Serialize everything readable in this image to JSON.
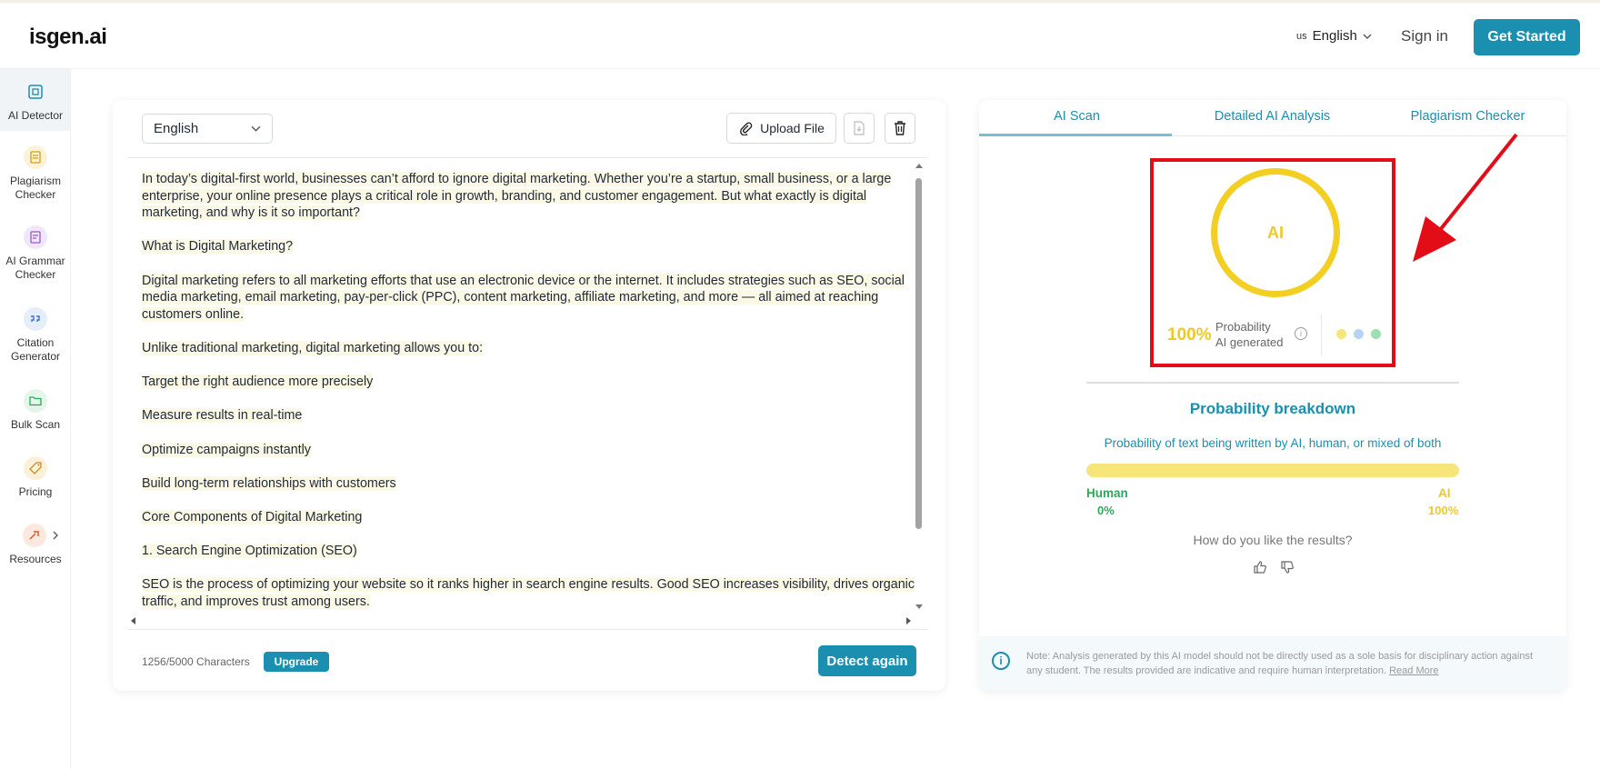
{
  "header": {
    "logo": "isgen.ai",
    "language_flag": "us",
    "language": "English",
    "sign_in": "Sign in",
    "get_started": "Get Started"
  },
  "sidebar": {
    "items": [
      {
        "label": "AI Detector",
        "icon": "ai-detector-icon"
      },
      {
        "label": "Plagiarism Checker",
        "icon": "plagiarism-icon"
      },
      {
        "label": "AI Grammar Checker",
        "icon": "grammar-icon"
      },
      {
        "label": "Citation Generator",
        "icon": "citation-icon"
      },
      {
        "label": "Bulk Scan",
        "icon": "folder-icon"
      },
      {
        "label": "Pricing",
        "icon": "price-tag-icon"
      },
      {
        "label": "Resources",
        "icon": "resources-icon"
      }
    ]
  },
  "editor": {
    "language_select": "English",
    "upload_label": "Upload File",
    "paragraphs": [
      "In today’s digital-first world, businesses can’t afford to ignore digital marketing. Whether you’re a startup, small business, or a large enterprise, your online presence plays a critical role in growth, branding, and customer engagement. But what exactly is digital marketing, and why is it so important?",
      "What is Digital Marketing?",
      "Digital marketing refers to all marketing efforts that use an electronic device or the internet. It includes strategies such as SEO, social media marketing, email marketing, pay-per-click (PPC), content marketing, affiliate marketing, and more — all aimed at reaching customers online.",
      "Unlike traditional marketing, digital marketing allows you to:",
      "Target the right audience more precisely",
      "Measure results in real-time",
      "Optimize campaigns instantly",
      "Build long-term relationships with customers",
      "Core Components of Digital Marketing",
      "1. Search Engine Optimization (SEO)",
      "SEO is the process of optimizing your website so it ranks higher in search engine results. Good SEO increases visibility, drives organic traffic, and improves trust among users."
    ],
    "char_count": "1256/5000 Characters",
    "upgrade": "Upgrade",
    "detect_again": "Detect again"
  },
  "results": {
    "tabs": [
      "AI Scan",
      "Detailed AI Analysis",
      "Plagiarism Checker"
    ],
    "ring_label": "AI",
    "percent": "100%",
    "prob_line1": "Probability",
    "prob_line2": "AI generated",
    "dot_colors": [
      "#f6e67a",
      "#b9d3f5",
      "#9be0b0"
    ],
    "breakdown_title": "Probability breakdown",
    "breakdown_sub": "Probability of text being written by AI, human, or mixed of both",
    "ai_fraction": 1.0,
    "human_label": "Human",
    "human_value": "0%",
    "ai_label": "AI",
    "ai_value": "100%",
    "feedback_q": "How do you like the results?",
    "note": "Note: Analysis generated by this AI model should not be directly used as a sole basis for disciplinary action against any student. The results provided are indicative and require human interpretation.",
    "read_more": "Read More"
  },
  "colors": {
    "accent": "#1a8fb0",
    "ai_yellow": "#f4cf23",
    "human_green": "#2fa85a",
    "highlight_red": "#e30d17"
  }
}
